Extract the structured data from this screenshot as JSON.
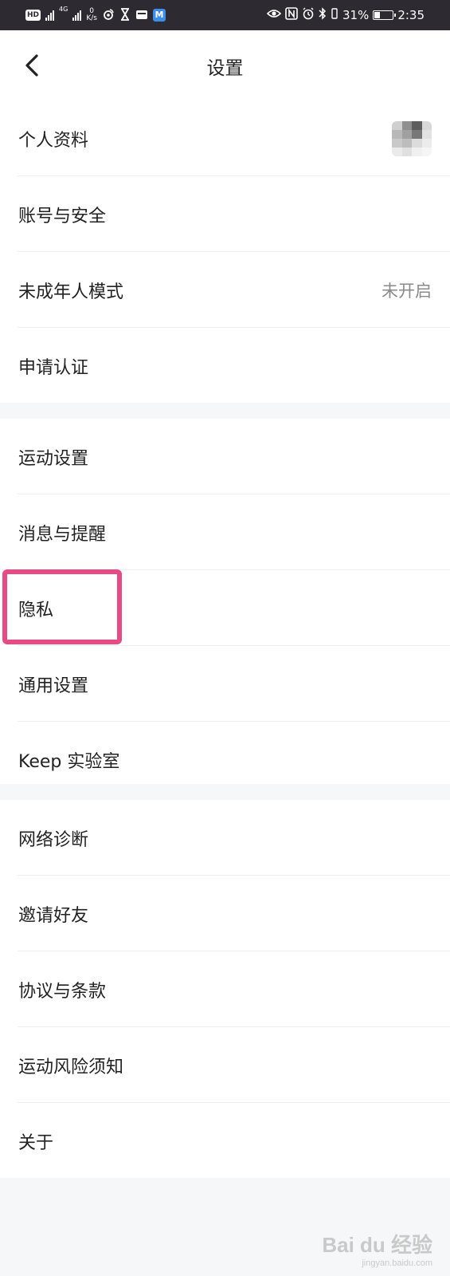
{
  "status_bar": {
    "hd_label": "HD",
    "network_label": "4G",
    "net_speed_value": "0",
    "net_speed_unit": "K/s",
    "app_badge": "M",
    "battery_percent": "31%",
    "battery_level": 0.31,
    "time": "2:35",
    "icons": [
      "hd-icon",
      "signal-icon",
      "signal-4g-icon",
      "weibo-icon",
      "hourglass-icon",
      "message-icon",
      "app-m-icon",
      "eye-icon",
      "nfc-icon",
      "alarm-icon",
      "bluetooth-icon",
      "vibrate-icon",
      "battery-icon"
    ]
  },
  "header": {
    "title": "设置",
    "back_icon": "chevron-left-icon"
  },
  "groups": [
    {
      "items": [
        {
          "label": "个人资料",
          "accessory": "avatar"
        },
        {
          "label": "账号与安全"
        },
        {
          "label": "未成年人模式",
          "value": "未开启"
        },
        {
          "label": "申请认证"
        }
      ]
    },
    {
      "items": [
        {
          "label": "运动设置"
        },
        {
          "label": "消息与提醒"
        },
        {
          "label": "隐私",
          "highlighted": true
        },
        {
          "label": "通用设置"
        },
        {
          "label": "Keep 实验室"
        }
      ]
    },
    {
      "items": [
        {
          "label": "网络诊断"
        },
        {
          "label": "邀请好友"
        },
        {
          "label": "协议与条款"
        },
        {
          "label": "运动风险须知"
        },
        {
          "label": "关于"
        }
      ]
    }
  ],
  "watermark": {
    "main": "Bai du 经验",
    "sub": "jingyan.baidu.com"
  },
  "colors": {
    "status_bar_bg": "#2e2a31",
    "highlight_border": "#e84a86",
    "separator_bg": "#f6f7f8",
    "secondary_text": "#8a8a8a"
  }
}
